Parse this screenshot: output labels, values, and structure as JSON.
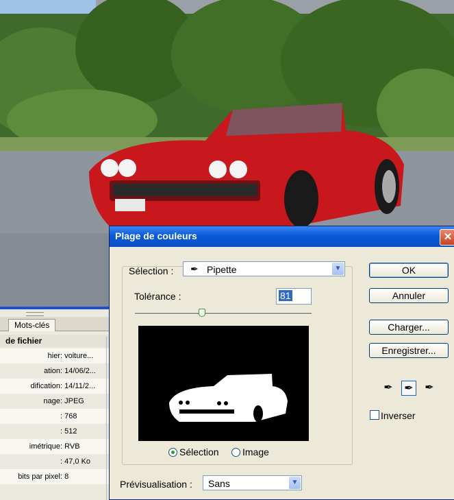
{
  "dialog": {
    "title": "Plage de couleurs",
    "close_label": "✕",
    "selection_label": "Sélection :",
    "selection_value": "Pipette",
    "tolerance_label": "Tolérance :",
    "tolerance_value": "81",
    "tolerance_fraction": 0.38,
    "radio_selection": "Sélection",
    "radio_image": "Image",
    "preview_label": "Prévisualisation :",
    "preview_value": "Sans",
    "buttons": {
      "ok": "OK",
      "cancel": "Annuler",
      "load": "Charger...",
      "save": "Enregistrer..."
    },
    "invert_label": "Inverser"
  },
  "info_panel": {
    "tab": "Mots-clés",
    "section": "de fichier",
    "rows": [
      {
        "key": "hier",
        "value": ": voiture..."
      },
      {
        "key": "ation",
        "value": ": 14/06/2..."
      },
      {
        "key": "dification",
        "value": ": 14/11/2..."
      },
      {
        "key": "nage",
        "value": ": JPEG"
      },
      {
        "key": "",
        "value": ": 768"
      },
      {
        "key": "",
        "value": ": 512"
      },
      {
        "key": "imétrique",
        "value": ": RVB"
      },
      {
        "key": "",
        "value": ": 47,0 Ko"
      },
      {
        "key": "bits par pixel",
        "value": ": 8"
      }
    ]
  },
  "colors": {
    "title_blue": "#0a5ad8",
    "car_red": "#c8181e",
    "dialog_bg": "#ece9d8"
  }
}
